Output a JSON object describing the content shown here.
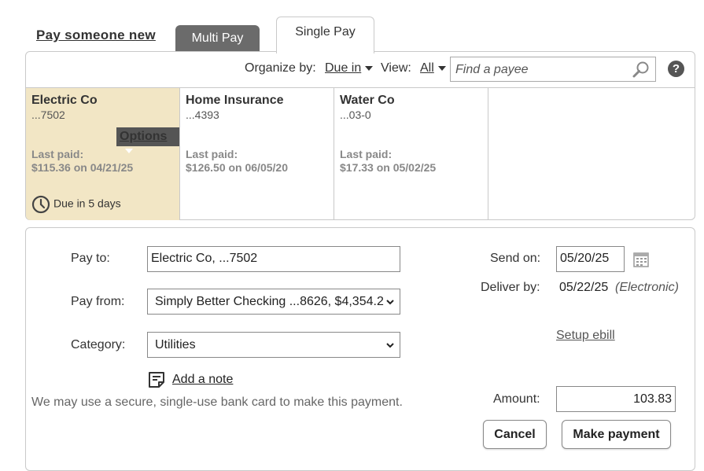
{
  "nav": {
    "pay_someone_new": "Pay someone new",
    "tabs": [
      {
        "label": "Multi Pay",
        "active": false
      },
      {
        "label": "Single Pay",
        "active": true
      }
    ]
  },
  "toolbar": {
    "organize_label": "Organize by:",
    "organize_value": "Due in",
    "view_label": "View:",
    "view_value": "All",
    "search_placeholder": "Find a payee",
    "help": "?"
  },
  "payees": [
    {
      "name": "Electric Co",
      "account": "...7502",
      "last_paid_label": "Last paid:",
      "last_paid": "$115.36 on 04/21/25",
      "options": "Options",
      "due": "Due in 5 days",
      "selected": true
    },
    {
      "name": "Home Insurance",
      "account": "...4393",
      "last_paid_label": "Last paid:",
      "last_paid": "$126.50 on 06/05/20"
    },
    {
      "name": "Water Co",
      "account": "...03-0",
      "last_paid_label": "Last paid:",
      "last_paid": "$17.33 on 05/02/25"
    }
  ],
  "form": {
    "pay_to_label": "Pay to:",
    "pay_to_value": "Electric Co, ...7502",
    "pay_from_label": "Pay from:",
    "pay_from_value": "Simply Better Checking ...8626, $4,354.2",
    "category_label": "Category:",
    "category_value": "Utilities",
    "add_note": "Add a note",
    "disclaimer": "We may use a secure, single-use bank card to make this payment.",
    "send_on_label": "Send on:",
    "send_on_value": "05/20/25",
    "deliver_by_label": "Deliver by:",
    "deliver_by_value": "05/22/25",
    "deliver_method": "(Electronic)",
    "setup_ebill": "Setup ebill",
    "amount_label": "Amount:",
    "amount_value": "103.83",
    "cancel": "Cancel",
    "make_payment": "Make payment"
  },
  "colors": {
    "selected_card": "#f2e6c5",
    "tab_inactive": "#6b6b6b",
    "options_bg": "#555555"
  }
}
